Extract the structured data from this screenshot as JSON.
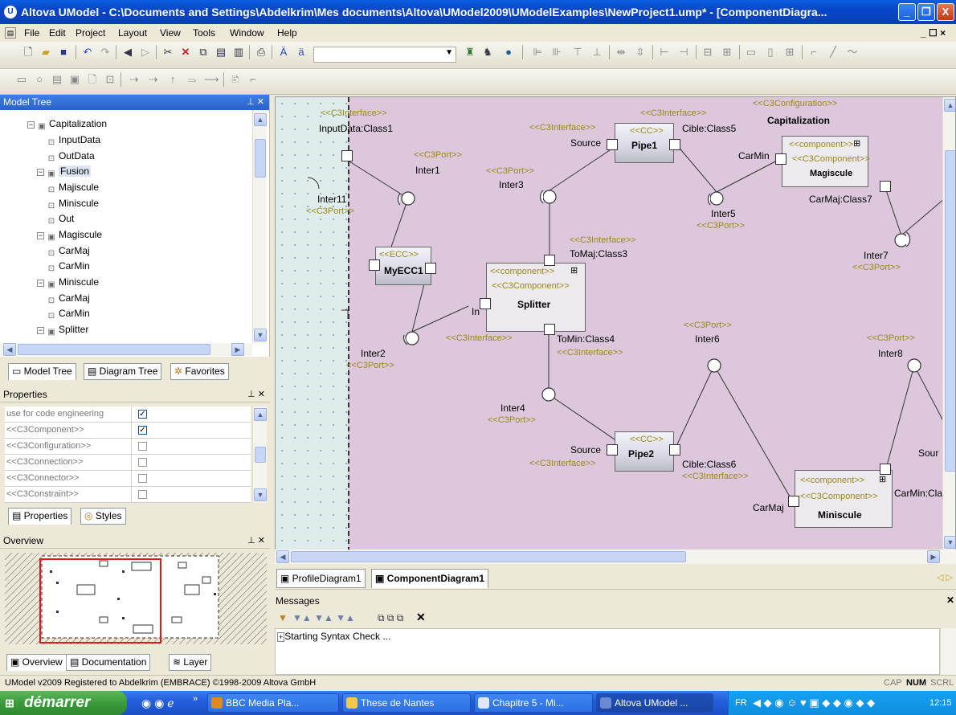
{
  "window": {
    "title": "Altova UModel - C:\\Documents and Settings\\Abdelkrim\\Mes documents\\Altova\\UModel2009\\UModelExamples\\NewProject1.ump* - [ComponentDiagra...",
    "btn_min": "_",
    "btn_max": "❐",
    "btn_close": "X"
  },
  "menu": {
    "items": [
      "File",
      "Edit",
      "Project",
      "Layout",
      "View",
      "Tools",
      "Window",
      "Help"
    ],
    "mdi_controls": "_ ☐ ×"
  },
  "model_tree": {
    "header": "Model Tree",
    "items": [
      {
        "label": "Capitalization",
        "type": "component"
      },
      {
        "label": "InputData",
        "type": "port"
      },
      {
        "label": "OutData",
        "type": "port"
      },
      {
        "label": "Fusion",
        "type": "component"
      },
      {
        "label": "Majiscule",
        "type": "port"
      },
      {
        "label": "Miniscule",
        "type": "port"
      },
      {
        "label": "Out",
        "type": "port"
      },
      {
        "label": "Magiscule",
        "type": "component"
      },
      {
        "label": "CarMaj",
        "type": "port"
      },
      {
        "label": "CarMin",
        "type": "port"
      },
      {
        "label": "Miniscule",
        "type": "component"
      },
      {
        "label": "CarMaj",
        "type": "port"
      },
      {
        "label": "CarMin",
        "type": "port"
      },
      {
        "label": "Splitter",
        "type": "component"
      }
    ],
    "tabs": [
      "Model Tree",
      "Diagram Tree",
      "Favorites"
    ]
  },
  "properties": {
    "header": "Properties",
    "rows": [
      {
        "name": "use for code engineering",
        "checked": true
      },
      {
        "name": "<<C3Component>>",
        "checked": true
      },
      {
        "name": "<<C3Configuration>>",
        "checked": false
      },
      {
        "name": "<<C3Connection>>",
        "checked": false
      },
      {
        "name": "<<C3Connector>>",
        "checked": false
      },
      {
        "name": "<<C3Constraint>>",
        "checked": false
      }
    ],
    "tabs": [
      "Properties",
      "Styles"
    ]
  },
  "overview": {
    "header": "Overview",
    "tabs": [
      "Overview",
      "Documentation",
      "Layer"
    ]
  },
  "diagram": {
    "tabs": [
      "ProfileDiagram1",
      "ComponentDiagram1"
    ],
    "labels": {
      "c3interface": "<<C3Interface>>",
      "c3port": "<<C3Port>>",
      "c3configuration": "<<C3Configuration>>",
      "component": "<<component>>",
      "c3component": "<<C3Component>>",
      "cc": "<<CC>>",
      "ecc": "<<ECC>>",
      "capitalization": "Capitalization",
      "pipe1": "Pipe1",
      "pipe2": "Pipe2",
      "magiscule": "Magiscule",
      "miniscule": "Miniscule",
      "splitter": "Splitter",
      "myecc1": "MyECC1",
      "inputdata": "InputData:Class1",
      "cible5": "Cible:Class5",
      "cible6": "Cible:Class6",
      "tomaj": "ToMaj:Class3",
      "tomin": "ToMin:Class4",
      "carmaj7": "CarMaj:Class7",
      "carmin_cla": "CarMin:Cla",
      "source": "Source",
      "sour": "Sour",
      "carmin": "CarMin",
      "carmaj": "CarMaj",
      "in": "In",
      "inter1": "Inter1",
      "inter11": "Inter11",
      "inter2": "Inter2",
      "inter3": "Inter3",
      "inter4": "Inter4",
      "inter5": "Inter5",
      "inter6": "Inter6",
      "inter7": "Inter7",
      "inter8": "Inter8"
    }
  },
  "messages": {
    "header": "Messages",
    "line": "Starting Syntax Check ..."
  },
  "status": {
    "left": "UModel v2009   Registered to Abdelkrim (EMBRACE)  ©1998-2009 Altova GmbH",
    "cap": "CAP",
    "num": "NUM",
    "scrl": "SCRL"
  },
  "taskbar": {
    "start": "démarrer",
    "tasks": [
      "BBC Media Pla...",
      "These de Nantes",
      "Chapitre 5 - Mi...",
      "Altova UModel ..."
    ],
    "lang": "FR",
    "clock": "12:15"
  },
  "colors": {
    "diagram_bg": "#dcc7dd",
    "xp_blue": "#0a3fb8",
    "stereo": "#9a8a16"
  }
}
